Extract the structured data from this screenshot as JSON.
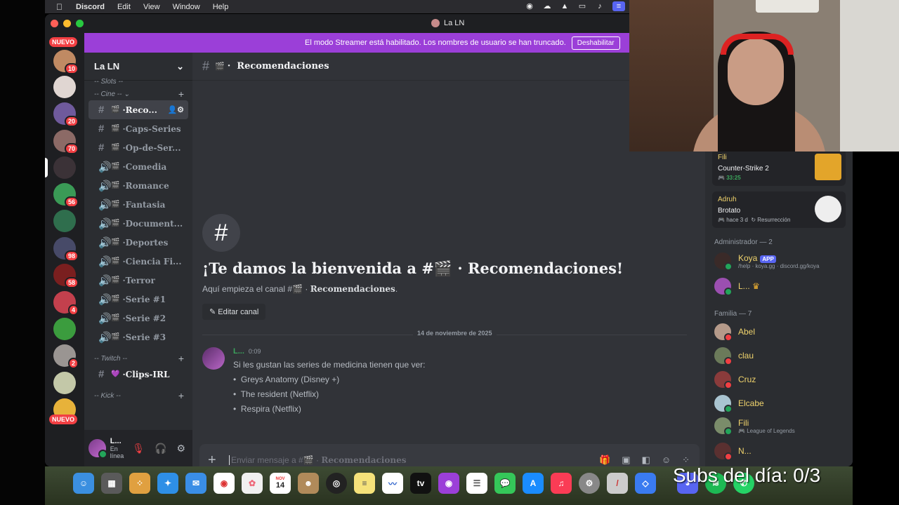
{
  "menubar": {
    "app": "Discord",
    "items": [
      "Edit",
      "View",
      "Window",
      "Help"
    ]
  },
  "window": {
    "title": "La LN"
  },
  "banner": {
    "text": "El modo Streamer está habilitado. Los nombres de usuario se han truncado.",
    "button": "Deshabilitar"
  },
  "rail": {
    "nuevo_top": "NUEVO",
    "nuevo_bottom": "NUEVO",
    "badges": [
      "10",
      "20",
      "70",
      "56",
      "98",
      "58",
      "4",
      "2"
    ]
  },
  "sidebar": {
    "guild_name": "La LN",
    "categories": {
      "slots": "-- Slots --",
      "cine": "-- Cine --",
      "twitch": "-- Twitch --",
      "kick": "-- Kick --"
    },
    "channels": [
      {
        "name": "Reco...",
        "type": "text"
      },
      {
        "name": "Caps-Series",
        "type": "text"
      },
      {
        "name": "Op-de-Ser...",
        "type": "text"
      },
      {
        "name": "Comedia",
        "type": "voice"
      },
      {
        "name": "Romance",
        "type": "voice"
      },
      {
        "name": "Fantasia",
        "type": "voice"
      },
      {
        "name": "Document...",
        "type": "voice"
      },
      {
        "name": "Deportes",
        "type": "voice"
      },
      {
        "name": "Ciencia Fi...",
        "type": "voice"
      },
      {
        "name": "Terror",
        "type": "voice"
      },
      {
        "name": "Serie #1",
        "type": "voice"
      },
      {
        "name": "Serie #2",
        "type": "voice"
      },
      {
        "name": "Serie #3",
        "type": "voice"
      }
    ],
    "twitch_channel": "Clips-IRL",
    "user": {
      "name": "L...",
      "status": "En línea"
    }
  },
  "chat": {
    "channel": "Recomendaciones",
    "welcome_title": "¡Te damos la bienvenida a #🎬 · Recomendaciones!",
    "welcome_sub_prefix": "Aquí empieza el canal #🎬 · ",
    "welcome_sub_channel": "Recomendaciones",
    "edit_button": "Editar canal",
    "date_divider": "14 de noviembre de 2025",
    "message": {
      "author": "L...",
      "time": "0:09",
      "text": "Si les gustan las series de medicina tienen que ver:",
      "bullets": [
        "Greys Anatomy (Disney +)",
        "The resident (Netflix)",
        "Respira (Netflix)"
      ]
    },
    "composer_placeholder": "Enviar mensaje a #🎬 · ",
    "composer_channel": "Recomendaciones"
  },
  "members": {
    "activities": [
      {
        "user": "Fili",
        "game": "Counter-Strike 2",
        "time": "33:25"
      },
      {
        "user": "Adruh",
        "game": "Brotato",
        "time": "hace 3 d",
        "extra": "Resurrección"
      }
    ],
    "admin_header": "Administrador — 2",
    "admins": [
      {
        "name": "Koya",
        "badge": "APP",
        "sub": "/help · koya.gg · discord.gg/koya"
      },
      {
        "name": "L..."
      }
    ],
    "family_header": "Familia — 7",
    "family": [
      {
        "name": "Abel"
      },
      {
        "name": "clau"
      },
      {
        "name": "Cruz"
      },
      {
        "name": "Elcabe"
      },
      {
        "name": "Fili",
        "sub": "League of Legends"
      },
      {
        "name": "N..."
      }
    ]
  },
  "dock": {
    "calendar_month": "NOV",
    "calendar_day": "14"
  },
  "overlay": {
    "subs": "Subs del día: 0/3"
  },
  "colors": {
    "banner": "#9b3fd8",
    "online": "#23a55a",
    "badge": "#f23f43"
  }
}
